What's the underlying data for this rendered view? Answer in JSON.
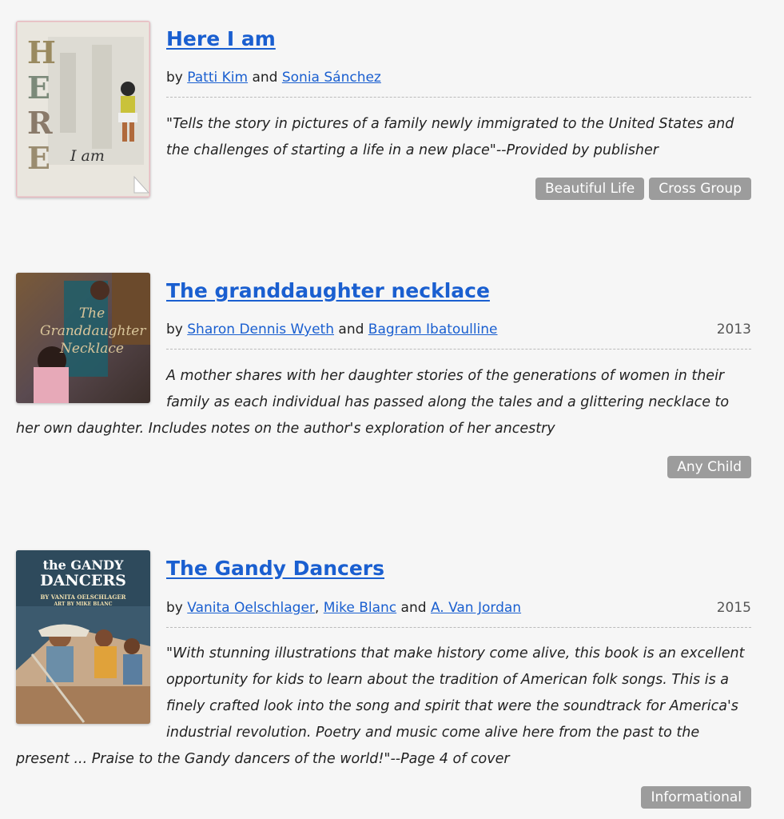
{
  "books": [
    {
      "title": "Here I am",
      "by": "by",
      "authors": [
        "Patti Kim",
        "Sonia Sánchez"
      ],
      "sep": "and",
      "year": "",
      "description": "\"Tells the story in pictures of a family newly immigrated to the United States and the challenges of starting a life in a new place\"--Provided by publisher",
      "tags": [
        "Beautiful Life",
        "Cross Group"
      ],
      "cover": {
        "letters": [
          "H",
          "E",
          "R",
          "E"
        ],
        "script": "I am"
      }
    },
    {
      "title": "The granddaughter necklace",
      "by": "by",
      "authors": [
        "Sharon Dennis Wyeth",
        "Bagram Ibatoulline"
      ],
      "sep": "and",
      "year": "2013",
      "description": "A mother shares with her daughter stories of the generations of women in their family as each individual has passed along the tales and a glittering necklace to her own daughter. Includes notes on the author's exploration of her ancestry",
      "tags": [
        "Any Child"
      ],
      "cover": {
        "line1": "The",
        "line2": "Granddaughter",
        "line3": "Necklace"
      }
    },
    {
      "title": "The Gandy Dancers",
      "by": "by",
      "authors": [
        "Vanita Oelschlager",
        "Mike Blanc",
        "A. Van Jordan"
      ],
      "sep": "and",
      "comma": ",",
      "year": "2015",
      "description": "\"With stunning illustrations that make history come alive, this book is an excellent opportunity for kids to learn about the tradition of American folk songs. This is a finely crafted look into the song and spirit that were the soundtrack for America's industrial revolution. Poetry and music come alive here from the past to the present ... Praise to the Gandy dancers of the world!\"--Page 4 of cover",
      "tags": [
        "Informational"
      ],
      "cover": {
        "line1": "the GANDY",
        "line2": "DANCERS",
        "line3": "BY VANITA OELSCHLAGER",
        "line4": "ART BY MIKE BLANC"
      }
    }
  ]
}
